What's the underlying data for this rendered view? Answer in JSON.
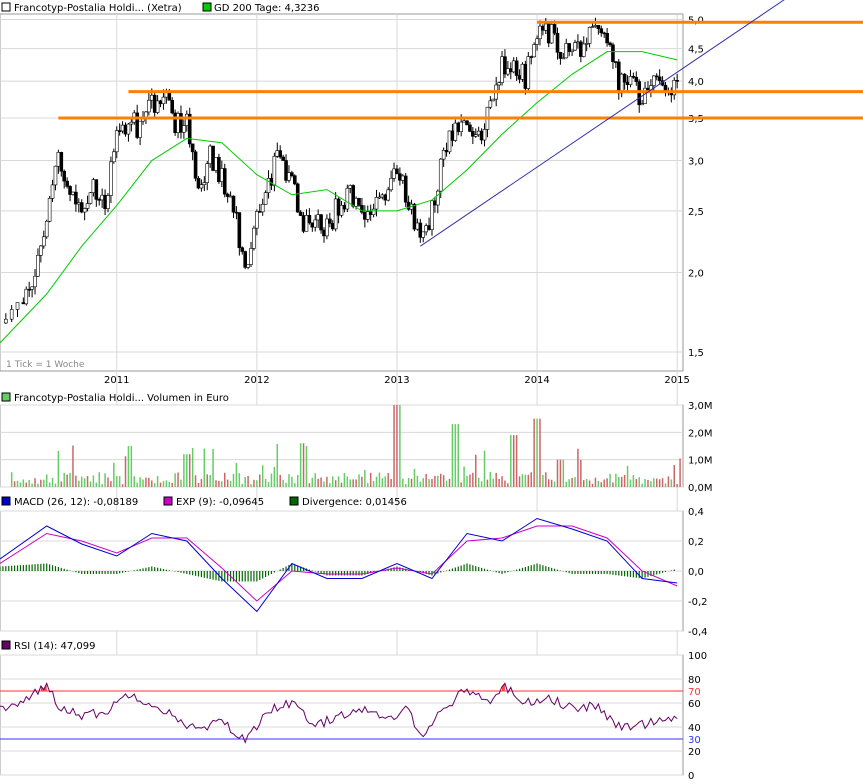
{
  "legend": {
    "price_label": "Francotyp-Postalia Holdi... (Xetra)",
    "ma_label": "GD 200 Tage: 4,3236",
    "tick_note": "1 Tick = 1 Woche",
    "volume_label": "Francotyp-Postalia Holdi... Volumen in Euro",
    "macd_label": "MACD (26, 12): -0,08189",
    "exp_label": "EXP (9): -0,09645",
    "div_label": "Divergence: 0,01456",
    "rsi_label": "RSI (14): 47,099"
  },
  "colors": {
    "price_up": "#ffffff",
    "price_down": "#000000",
    "ma200": "#00cc00",
    "orange_lines": "#ff7f00",
    "trend_line": "#3333aa",
    "vol_up": "#66cc66",
    "vol_down": "#cc6666",
    "macd": "#0000cc",
    "exp": "#cc00cc",
    "divergence": "#006600",
    "rsi": "#660066",
    "rsi_70": "#ff3333",
    "rsi_30": "#3333ff",
    "grid": "#d8d8d8"
  },
  "chart_data": [
    {
      "type": "line",
      "name": "price",
      "x_tick_labels": [
        "2011",
        "2012",
        "2013",
        "2014",
        "2015"
      ],
      "y_tick_labels": [
        "1,5",
        "2,0",
        "2,5",
        "3,0",
        "3,5",
        "4,0",
        "4,5",
        "5,0"
      ],
      "ylim": [
        1.4,
        5.1
      ],
      "y_scale": "log",
      "x_range": [
        "2010-03",
        "2015-01"
      ],
      "series": [
        {
          "name": "Francotyp-Postalia Holdi... (Xetra)",
          "points": [
            [
              "2010-03",
              1.65
            ],
            [
              "2010-05",
              1.75
            ],
            [
              "2010-06",
              2.0
            ],
            [
              "2010-07",
              2.5
            ],
            [
              "2010-08",
              3.1
            ],
            [
              "2010-09",
              2.6
            ],
            [
              "2010-10",
              2.55
            ],
            [
              "2010-11",
              2.75
            ],
            [
              "2010-12",
              2.6
            ],
            [
              "2011-01",
              3.25
            ],
            [
              "2011-02",
              3.5
            ],
            [
              "2011-03",
              3.35
            ],
            [
              "2011-04",
              3.65
            ],
            [
              "2011-05",
              3.8
            ],
            [
              "2011-06",
              3.45
            ],
            [
              "2011-07",
              3.4
            ],
            [
              "2011-08",
              2.7
            ],
            [
              "2011-09",
              3.05
            ],
            [
              "2011-10",
              2.8
            ],
            [
              "2011-11",
              2.6
            ],
            [
              "2011-12",
              1.95
            ],
            [
              "2012-01",
              2.4
            ],
            [
              "2012-02",
              2.8
            ],
            [
              "2012-03",
              3.05
            ],
            [
              "2012-04",
              2.75
            ],
            [
              "2012-05",
              2.4
            ],
            [
              "2012-06",
              2.45
            ],
            [
              "2012-07",
              2.35
            ],
            [
              "2012-08",
              2.55
            ],
            [
              "2012-09",
              2.65
            ],
            [
              "2012-10",
              2.55
            ],
            [
              "2012-11",
              2.5
            ],
            [
              "2012-12",
              2.7
            ],
            [
              "2013-01",
              2.9
            ],
            [
              "2013-02",
              2.6
            ],
            [
              "2013-03",
              2.2
            ],
            [
              "2013-04",
              2.5
            ],
            [
              "2013-05",
              3.1
            ],
            [
              "2013-06",
              3.4
            ],
            [
              "2013-07",
              3.3
            ],
            [
              "2013-08",
              3.3
            ],
            [
              "2013-09",
              3.6
            ],
            [
              "2013-10",
              4.3
            ],
            [
              "2013-11",
              4.15
            ],
            [
              "2013-12",
              4.05
            ],
            [
              "2014-01",
              4.7
            ],
            [
              "2014-02",
              4.8
            ],
            [
              "2014-03",
              4.5
            ],
            [
              "2014-04",
              4.45
            ],
            [
              "2014-05",
              4.6
            ],
            [
              "2014-06",
              4.7
            ],
            [
              "2014-07",
              4.6
            ],
            [
              "2014-08",
              4.0
            ],
            [
              "2014-09",
              4.05
            ],
            [
              "2014-10",
              3.7
            ],
            [
              "2014-11",
              4.0
            ],
            [
              "2014-12",
              3.95
            ],
            [
              "2015-01",
              4.0
            ]
          ]
        },
        {
          "name": "GD 200 Tage: 4,3236",
          "points": [
            [
              "2010-03",
              1.55
            ],
            [
              "2010-07",
              1.85
            ],
            [
              "2010-10",
              2.2
            ],
            [
              "2011-01",
              2.55
            ],
            [
              "2011-04",
              3.0
            ],
            [
              "2011-07",
              3.25
            ],
            [
              "2011-10",
              3.2
            ],
            [
              "2012-01",
              2.85
            ],
            [
              "2012-04",
              2.65
            ],
            [
              "2012-07",
              2.7
            ],
            [
              "2012-10",
              2.5
            ],
            [
              "2013-01",
              2.5
            ],
            [
              "2013-04",
              2.6
            ],
            [
              "2013-07",
              2.9
            ],
            [
              "2013-10",
              3.3
            ],
            [
              "2014-01",
              3.7
            ],
            [
              "2014-04",
              4.1
            ],
            [
              "2014-07",
              4.45
            ],
            [
              "2014-10",
              4.45
            ],
            [
              "2015-01",
              4.32
            ]
          ]
        }
      ],
      "horizontal_lines": [
        {
          "y": 4.95,
          "from": "2014-01"
        },
        {
          "y": 3.85,
          "from": "2011-02"
        },
        {
          "y": 3.5,
          "from": "2010-08"
        }
      ],
      "trend_line": [
        [
          "2013-03",
          2.2
        ],
        [
          "2015-11",
          5.5
        ]
      ]
    },
    {
      "type": "bar",
      "name": "volume",
      "y_tick_labels": [
        "0,0M",
        "1,0M",
        "2,0M",
        "3,0M"
      ],
      "ylim": [
        0,
        3.0
      ],
      "peaks": [
        [
          "2011-02",
          1.5
        ],
        [
          "2011-07",
          1.2
        ],
        [
          "2012-05",
          1.6
        ],
        [
          "2013-01",
          3.0
        ],
        [
          "2013-06",
          2.3
        ],
        [
          "2013-11",
          1.9
        ],
        [
          "2014-01",
          2.5
        ],
        [
          "2014-03",
          1.0
        ]
      ]
    },
    {
      "type": "line",
      "name": "macd",
      "y_tick_labels": [
        "-0,4",
        "-0,2",
        "0,0",
        "0,2",
        "0,4"
      ],
      "ylim": [
        -0.4,
        0.4
      ],
      "series": [
        {
          "name": "MACD (26, 12): -0,08189",
          "points": [
            [
              "2010-03",
              0.08
            ],
            [
              "2010-07",
              0.3
            ],
            [
              "2010-10",
              0.18
            ],
            [
              "2011-01",
              0.1
            ],
            [
              "2011-04",
              0.25
            ],
            [
              "2011-07",
              0.2
            ],
            [
              "2011-10",
              -0.05
            ],
            [
              "2012-01",
              -0.27
            ],
            [
              "2012-04",
              0.05
            ],
            [
              "2012-07",
              -0.05
            ],
            [
              "2012-10",
              -0.05
            ],
            [
              "2013-01",
              0.05
            ],
            [
              "2013-04",
              -0.05
            ],
            [
              "2013-07",
              0.25
            ],
            [
              "2013-10",
              0.2
            ],
            [
              "2014-01",
              0.35
            ],
            [
              "2014-04",
              0.28
            ],
            [
              "2014-07",
              0.2
            ],
            [
              "2014-10",
              -0.05
            ],
            [
              "2015-01",
              -0.08
            ]
          ]
        },
        {
          "name": "EXP (9): -0,09645",
          "points": [
            [
              "2010-03",
              0.05
            ],
            [
              "2010-07",
              0.25
            ],
            [
              "2010-10",
              0.2
            ],
            [
              "2011-01",
              0.12
            ],
            [
              "2011-04",
              0.22
            ],
            [
              "2011-07",
              0.22
            ],
            [
              "2011-10",
              0.02
            ],
            [
              "2012-01",
              -0.2
            ],
            [
              "2012-04",
              0.0
            ],
            [
              "2012-07",
              -0.02
            ],
            [
              "2012-10",
              -0.02
            ],
            [
              "2013-01",
              0.02
            ],
            [
              "2013-04",
              -0.02
            ],
            [
              "2013-07",
              0.2
            ],
            [
              "2013-10",
              0.22
            ],
            [
              "2014-01",
              0.3
            ],
            [
              "2014-04",
              0.3
            ],
            [
              "2014-07",
              0.22
            ],
            [
              "2014-10",
              0.0
            ],
            [
              "2015-01",
              -0.1
            ]
          ]
        },
        {
          "name": "Divergence: 0,01456",
          "points": [
            [
              "2010-03",
              0.03
            ],
            [
              "2010-07",
              0.05
            ],
            [
              "2010-10",
              -0.02
            ],
            [
              "2011-01",
              -0.02
            ],
            [
              "2011-04",
              0.03
            ],
            [
              "2011-07",
              -0.02
            ],
            [
              "2011-10",
              -0.07
            ],
            [
              "2012-01",
              -0.07
            ],
            [
              "2012-04",
              0.05
            ],
            [
              "2012-07",
              -0.03
            ],
            [
              "2012-10",
              -0.03
            ],
            [
              "2013-01",
              0.03
            ],
            [
              "2013-04",
              -0.03
            ],
            [
              "2013-07",
              0.05
            ],
            [
              "2013-10",
              -0.02
            ],
            [
              "2014-01",
              0.05
            ],
            [
              "2014-04",
              -0.02
            ],
            [
              "2014-07",
              -0.02
            ],
            [
              "2014-10",
              -0.05
            ],
            [
              "2015-01",
              0.015
            ]
          ]
        }
      ]
    },
    {
      "type": "line",
      "name": "rsi",
      "y_tick_labels": [
        "0",
        "20",
        "30",
        "40",
        "60",
        "70",
        "80",
        "100"
      ],
      "ylim": [
        0,
        100
      ],
      "levels": [
        70,
        30
      ],
      "series": [
        {
          "name": "RSI (14): 47,099",
          "points": [
            [
              "2010-03",
              55
            ],
            [
              "2010-05",
              60
            ],
            [
              "2010-07",
              76
            ],
            [
              "2010-08",
              58
            ],
            [
              "2010-10",
              50
            ],
            [
              "2010-12",
              52
            ],
            [
              "2011-02",
              68
            ],
            [
              "2011-04",
              60
            ],
            [
              "2011-06",
              48
            ],
            [
              "2011-08",
              37
            ],
            [
              "2011-10",
              45
            ],
            [
              "2011-12",
              28
            ],
            [
              "2012-02",
              55
            ],
            [
              "2012-04",
              60
            ],
            [
              "2012-06",
              40
            ],
            [
              "2012-08",
              50
            ],
            [
              "2012-10",
              55
            ],
            [
              "2012-12",
              45
            ],
            [
              "2013-02",
              55
            ],
            [
              "2013-03",
              33
            ],
            [
              "2013-05",
              55
            ],
            [
              "2013-07",
              72
            ],
            [
              "2013-09",
              60
            ],
            [
              "2013-10",
              75
            ],
            [
              "2013-12",
              60
            ],
            [
              "2014-02",
              65
            ],
            [
              "2014-04",
              55
            ],
            [
              "2014-06",
              58
            ],
            [
              "2014-08",
              40
            ],
            [
              "2014-10",
              42
            ],
            [
              "2014-12",
              48
            ],
            [
              "2015-01",
              47
            ]
          ]
        }
      ]
    }
  ]
}
